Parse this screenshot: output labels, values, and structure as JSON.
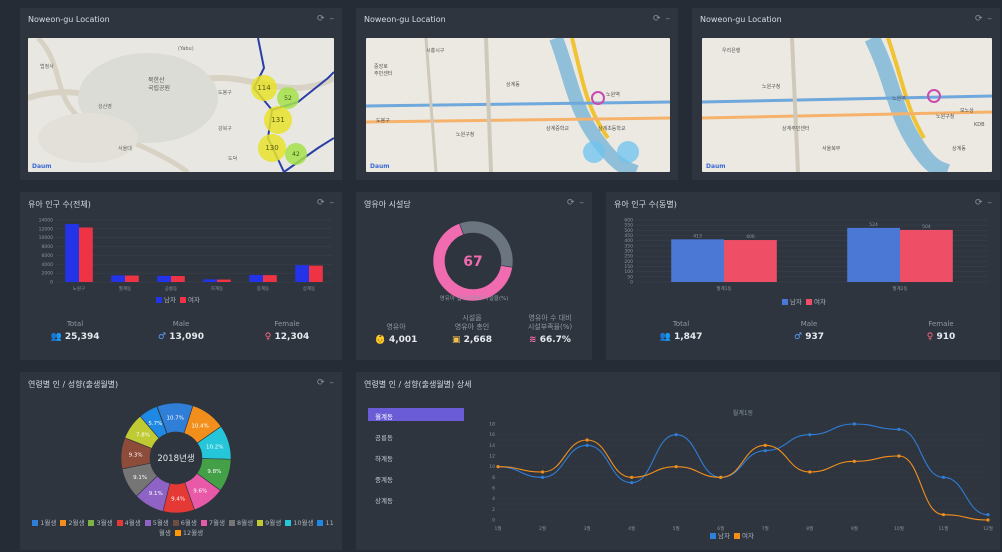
{
  "maps": [
    {
      "title": "Noweon-gu Location",
      "labels": [
        "법정사",
        "(Yabu)",
        "북한산",
        "국립공원",
        "성산영",
        "도봉구",
        "강북구",
        "서울대",
        "도덕"
      ],
      "clusters": [
        "114",
        "52",
        "131",
        "130",
        "42"
      ]
    },
    {
      "title": "Noweon-gu Location",
      "labels": [
        "시흥시구",
        "중앙로",
        "주민센터",
        "도봉구",
        "상계동",
        "노원구청",
        "상계중학교",
        "상계초등학교",
        "노원역"
      ]
    },
    {
      "title": "Noweon-gu Location",
      "labels": [
        "우리은행",
        "노원구청",
        "노원역",
        "상계주민센터",
        "노원구청",
        "모노상",
        "KDB",
        "서울북부",
        "상계동"
      ]
    }
  ],
  "map_brand": "Daum",
  "controls": {
    "refresh": "⟳",
    "minimize": "–"
  },
  "infant_total": {
    "title": "유아 인구 수(전체)",
    "legend": [
      "남자",
      "여자"
    ],
    "stats": [
      {
        "label": "Total",
        "value": "25,394",
        "icon": "users-icon"
      },
      {
        "label": "Male",
        "value": "13,090",
        "icon": "male-icon"
      },
      {
        "label": "Female",
        "value": "12,304",
        "icon": "female-icon"
      }
    ]
  },
  "facilities": {
    "title": "영유아 시설당",
    "gauge_value": "67",
    "gauge_caption": "영유아 입구수대비 시설율(%)",
    "stats": [
      {
        "label": "영유아",
        "value": "4,001",
        "icon": "baby-icon"
      },
      {
        "label": "시설을\n영유아 총인",
        "value": "2,668",
        "icon": "building-icon"
      },
      {
        "label": "영유아 수 대비\n시설부족율(%)",
        "value": "66.7%",
        "icon": "chart-icon"
      }
    ]
  },
  "infant_dong": {
    "title": "유아 인구 수(동별)",
    "legend": [
      "남자",
      "여자"
    ],
    "stats": [
      {
        "label": "Total",
        "value": "1,847",
        "icon": "users-icon"
      },
      {
        "label": "Male",
        "value": "937",
        "icon": "male-icon"
      },
      {
        "label": "Female",
        "value": "910",
        "icon": "female-icon"
      }
    ]
  },
  "birth_month": {
    "title": "연령별 인 / 성향(출생월별)",
    "center_label": "2018년생",
    "legend": [
      "1월생",
      "2월생",
      "3월생",
      "4월생",
      "5월생",
      "6월생",
      "7월생",
      "8월생",
      "9월생",
      "10월생",
      "11월생",
      "12월생"
    ],
    "colors": [
      "#2f7ed8",
      "#f28f1c",
      "#7cb342",
      "#e53935",
      "#8e63c5",
      "#6d4c41",
      "#e85aa8",
      "#757575",
      "#c0ca33",
      "#26c6da",
      "#1e88e5",
      "#ff9800"
    ]
  },
  "birth_detail": {
    "title": "연령별 인 / 성향(출생월별) 상세",
    "tabs": [
      "월계동",
      "공릉동",
      "하계동",
      "중계동",
      "상계동"
    ],
    "active_tab": 0,
    "legend": [
      "남자",
      "여자"
    ]
  },
  "chart_data": [
    {
      "type": "bar",
      "categories": [
        "노원구",
        "월계동",
        "공릉동",
        "하계동",
        "중계동",
        "상계동"
      ],
      "series": [
        {
          "name": "남자",
          "values": [
            13090,
            1500,
            1400,
            600,
            1600,
            3800
          ],
          "color": "#2233e8"
        },
        {
          "name": "여자",
          "values": [
            12304,
            1450,
            1350,
            550,
            1550,
            3700
          ],
          "color": "#ee3344"
        }
      ],
      "ylim": [
        0,
        14000
      ],
      "yticks": [
        0,
        2000,
        4000,
        6000,
        8000,
        10000,
        12000,
        14000
      ]
    },
    {
      "type": "pie",
      "values": [
        67,
        33
      ],
      "labels": [
        "",
        ""
      ],
      "colors": [
        "#f06baf",
        "#6b7580"
      ]
    },
    {
      "type": "bar",
      "categories": [
        "월계1동",
        "월계2동"
      ],
      "series": [
        {
          "name": "남자",
          "values": [
            413,
            524
          ],
          "color": "#4a78d4"
        },
        {
          "name": "여자",
          "values": [
            406,
            504
          ],
          "color": "#ee4f66"
        }
      ],
      "ylim": [
        0,
        600
      ],
      "yticks": [
        0,
        50,
        100,
        150,
        200,
        250,
        300,
        350,
        400,
        450,
        500,
        550,
        600
      ]
    },
    {
      "type": "pie",
      "values": [
        10.7,
        10.4,
        10.2,
        9.8,
        9.6,
        9.4,
        9.1,
        9.1,
        9.3,
        7.8,
        5.7,
        0.1
      ],
      "labels": [
        "10.7%",
        "10.4%",
        "10.2%",
        "9.8%",
        "9.6%",
        "9.4%",
        "9.1%",
        "9.1%",
        "9.3%",
        "7.8%",
        "5.7%",
        ""
      ],
      "colors": [
        "#2f7ed8",
        "#f28f1c",
        "#26c6da",
        "#43a047",
        "#e85aa8",
        "#e53935",
        "#8e63c5",
        "#757575",
        "#8d4b3a",
        "#c0ca33",
        "#1e88e5",
        "#ff9800"
      ]
    },
    {
      "type": "line",
      "title": "월계1동",
      "categories": [
        "1월",
        "2월",
        "3월",
        "4월",
        "5월",
        "6월",
        "7월",
        "8월",
        "9월",
        "10월",
        "11월",
        "12월"
      ],
      "series": [
        {
          "name": "남자",
          "values": [
            10,
            8,
            14,
            7,
            16,
            8,
            13,
            16,
            18,
            17,
            8,
            1
          ],
          "color": "#2f7ed8"
        },
        {
          "name": "여자",
          "values": [
            10,
            9,
            15,
            8,
            10,
            8,
            14,
            9,
            11,
            12,
            1,
            0
          ],
          "color": "#f28f1c"
        }
      ],
      "ylim": [
        0,
        18
      ],
      "yticks": [
        0,
        2,
        4,
        6,
        8,
        10,
        12,
        14,
        16,
        18
      ]
    }
  ]
}
